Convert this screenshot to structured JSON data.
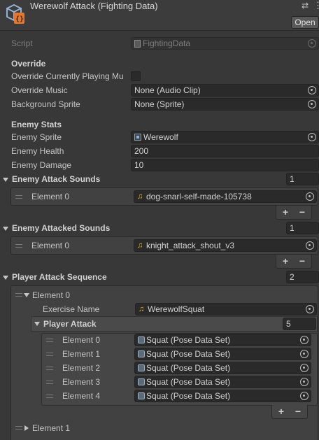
{
  "header": {
    "title": "Werewolf Attack (Fighting Data)",
    "open_label": "Open",
    "settings_glyph": "⇄",
    "menu_glyph": "⋮"
  },
  "script_row": {
    "label": "Script",
    "value": "FightingData"
  },
  "override": {
    "heading": "Override",
    "playing_label": "Override Currently Playing Mu",
    "music_label": "Override Music",
    "music_value": "None (Audio Clip)",
    "background_label": "Background Sprite",
    "background_value": "None (Sprite)"
  },
  "enemy_stats": {
    "heading": "Enemy Stats",
    "sprite_label": "Enemy Sprite",
    "sprite_value": "Werewolf",
    "health_label": "Enemy Health",
    "health_value": "200",
    "damage_label": "Enemy Damage",
    "damage_value": "10"
  },
  "attack_sounds": {
    "label": "Enemy Attack Sounds",
    "count": "1",
    "items": [
      {
        "label": "Element 0",
        "value": "dog-snarl-self-made-105738"
      }
    ]
  },
  "attacked_sounds": {
    "label": "Enemy Attacked Sounds",
    "count": "1",
    "items": [
      {
        "label": "Element 0",
        "value": "knight_attack_shout_v3"
      }
    ]
  },
  "player_sequence": {
    "label": "Player Attack Sequence",
    "count": "2",
    "element0": {
      "label": "Element 0",
      "exercise_label": "Exercise Name",
      "exercise_value": "WerewolfSquat",
      "player_attack": {
        "label": "Player Attack",
        "count": "5",
        "items": [
          {
            "label": "Element 0",
            "value": "Squat (Pose Data Set)"
          },
          {
            "label": "Element 1",
            "value": "Squat (Pose Data Set)"
          },
          {
            "label": "Element 2",
            "value": "Squat (Pose Data Set)"
          },
          {
            "label": "Element 3",
            "value": "Squat (Pose Data Set)"
          },
          {
            "label": "Element 4",
            "value": "Squat (Pose Data Set)"
          }
        ]
      }
    },
    "element1": {
      "label": "Element 1"
    }
  },
  "buttons": {
    "plus": "+",
    "minus": "−"
  }
}
